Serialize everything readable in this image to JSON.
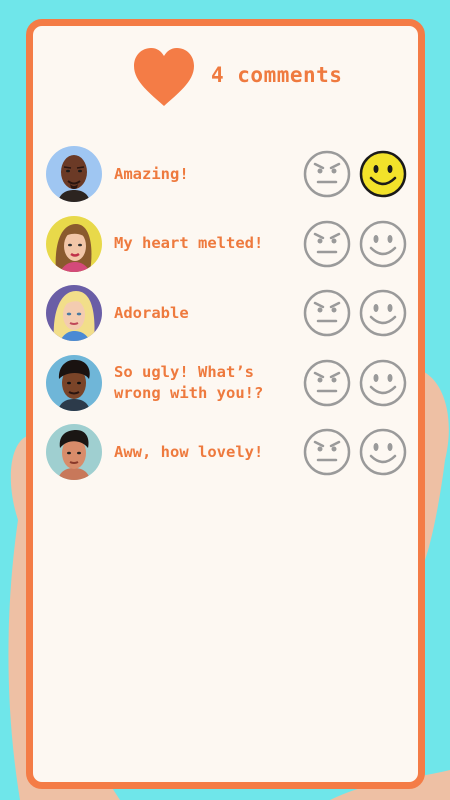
{
  "post": {
    "comment_count_label": "4 comments"
  },
  "comments": [
    {
      "text": "Amazing!",
      "avatar": "bald-man-avatar",
      "selected": "happy"
    },
    {
      "text": "My heart melted!",
      "avatar": "woman-brown-hair-avatar",
      "selected": "none"
    },
    {
      "text": "Adorable",
      "avatar": "blonde-woman-avatar",
      "selected": "none"
    },
    {
      "text": "So ugly! What’s\nwrong with you!?",
      "avatar": "curly-hair-man-avatar",
      "selected": "none"
    },
    {
      "text": "Aww, how lovely!",
      "avatar": "dark-hair-man-avatar",
      "selected": "none"
    }
  ],
  "colors": {
    "accent": "#f47c46",
    "background": "#6fe6ea",
    "screen": "#fdf8f2",
    "selected_face": "#f2e22a",
    "icon_gray": "#9a9a9a"
  }
}
